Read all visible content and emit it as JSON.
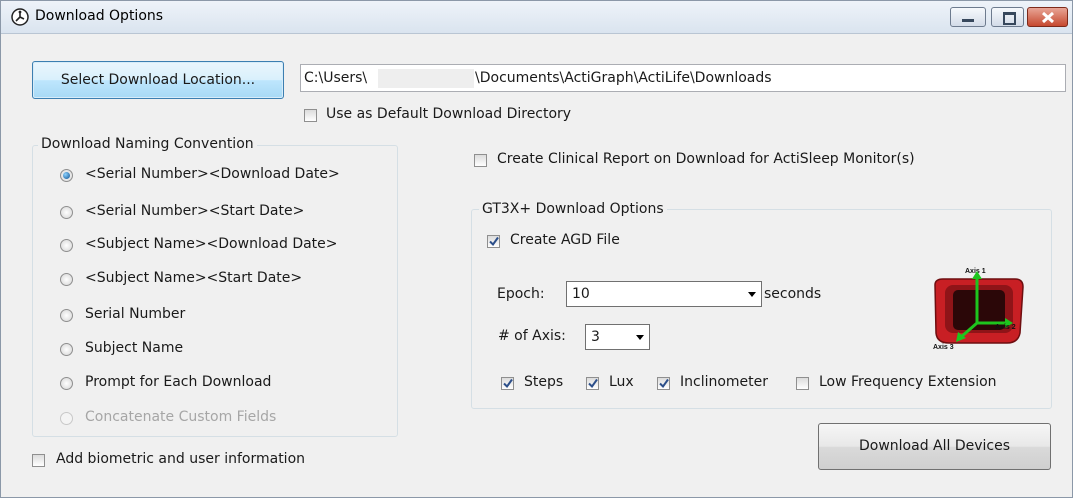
{
  "window": {
    "title": "Download Options"
  },
  "location": {
    "button_label": "Select Download Location...",
    "path_prefix": "C:\\Users\\",
    "path_suffix": "\\Documents\\ActiGraph\\ActiLife\\Downloads",
    "use_default_label": "Use as Default Download Directory",
    "use_default_checked": false
  },
  "naming": {
    "legend": "Download Naming Convention",
    "options": [
      {
        "label": "<Serial Number><Download Date>",
        "selected": true,
        "enabled": true
      },
      {
        "label": "<Serial Number><Start Date>",
        "selected": false,
        "enabled": true
      },
      {
        "label": "<Subject Name><Download Date>",
        "selected": false,
        "enabled": true
      },
      {
        "label": "<Subject Name><Start Date>",
        "selected": false,
        "enabled": true
      },
      {
        "label": "Serial Number",
        "selected": false,
        "enabled": true
      },
      {
        "label": "Subject Name",
        "selected": false,
        "enabled": true
      },
      {
        "label": "Prompt for Each Download",
        "selected": false,
        "enabled": true
      },
      {
        "label": "Concatenate Custom Fields",
        "selected": false,
        "enabled": false
      }
    ]
  },
  "biometric": {
    "label": "Add biometric and user information",
    "checked": false
  },
  "clinical": {
    "label": "Create Clinical Report on Download for ActiSleep Monitor(s)",
    "checked": false
  },
  "gt3x": {
    "legend": "GT3X+ Download Options",
    "create_agd_label": "Create AGD File",
    "create_agd_checked": true,
    "epoch_label": "Epoch:",
    "epoch_value": "10",
    "epoch_unit": "seconds",
    "axis_label": "# of Axis:",
    "axis_value": "3",
    "axis_image_labels": {
      "axis1": "Axis 1",
      "axis2": "Axis 2",
      "axis3": "Axis 3"
    },
    "options": [
      {
        "label": "Steps",
        "checked": true
      },
      {
        "label": "Lux",
        "checked": true
      },
      {
        "label": "Inclinometer",
        "checked": true
      },
      {
        "label": "Low Frequency Extension",
        "checked": false
      }
    ]
  },
  "download_button_label": "Download All Devices"
}
